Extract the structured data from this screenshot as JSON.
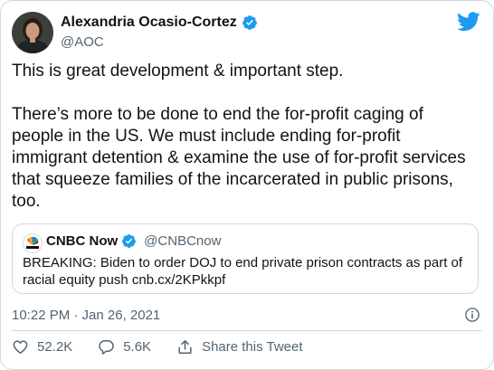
{
  "author": {
    "name": "Alexandria Ocasio-Cortez",
    "handle": "@AOC"
  },
  "tweet": {
    "paragraphs": [
      "This is great development & important step.",
      "There’s more to be done to end the for-profit caging of people in the US. We must include ending for-profit immigrant detention & examine the use of for-profit services that squeeze families of the incarcerated in public prisons, too."
    ],
    "timestamp": "10:22 PM · Jan 26, 2021"
  },
  "quoted": {
    "name": "CNBC Now",
    "handle": "@CNBCnow",
    "text": "BREAKING: Biden to order DOJ to end private prison contracts as part of racial equity push cnb.cx/2KPkkpf"
  },
  "actions": {
    "likes": "52.2K",
    "replies": "5.6K",
    "share_label": "Share this Tweet"
  },
  "colors": {
    "verified": "#1d9bf0",
    "twitter_blue": "#1d9bf0",
    "muted": "#536471",
    "border": "#cfd9de"
  },
  "icons": [
    "verified-badge-icon",
    "twitter-bird-icon",
    "info-icon",
    "heart-icon",
    "reply-icon",
    "share-icon",
    "cnbc-peacock-icon"
  ]
}
